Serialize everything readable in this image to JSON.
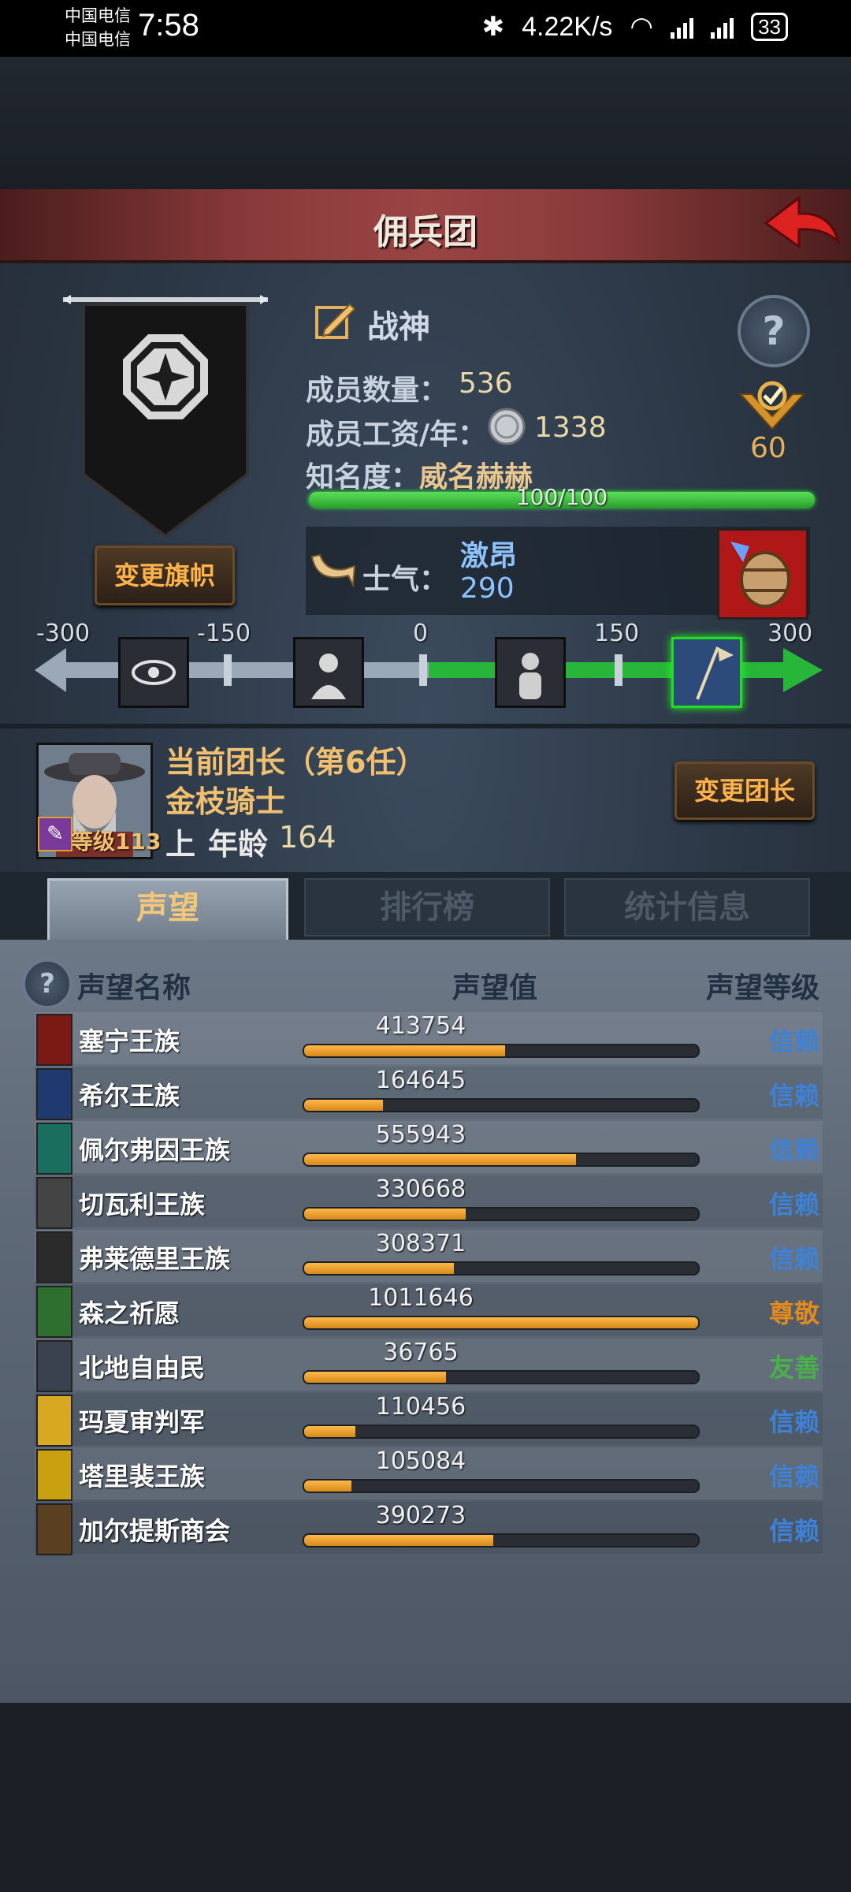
{
  "status": {
    "carrier1": "中国电信",
    "carrier2": "中国电信",
    "time": "7:58",
    "speed": "4.22K/s",
    "battery": "33"
  },
  "header": {
    "title": "佣兵团"
  },
  "guild": {
    "name": "战神",
    "member_count_label": "成员数量：",
    "member_count": "536",
    "wage_label": "成员工资/年：",
    "wage": "1338",
    "fame_label": "知名度：",
    "fame_value": "威名赫赫",
    "fame_text": "100/100",
    "fame_progress": 1.0,
    "rank_value": "60",
    "change_flag": "变更旗帜",
    "help": "?"
  },
  "morale": {
    "label": "士气：",
    "state": "激昂",
    "value": "290",
    "ticks": [
      "-300",
      "-150",
      "0",
      "150",
      "300"
    ],
    "level": 290,
    "range": [
      -300,
      300
    ]
  },
  "leader": {
    "title": "当前团长（第6任）",
    "name": "金枝骑士",
    "level": "等级113",
    "rank": "上",
    "age_label": "年龄",
    "age": "164",
    "change_button": "变更团长"
  },
  "tabs": [
    "声望",
    "排行榜",
    "统计信息"
  ],
  "table": {
    "col_name": "声望名称",
    "col_value": "声望值",
    "col_level": "声望等级",
    "rows": [
      {
        "name": "塞宁王族",
        "value": "413754",
        "fill": 0.51,
        "level": "信赖",
        "color": "#3b82d8",
        "icon": "#7a1a14"
      },
      {
        "name": "希尔王族",
        "value": "164645",
        "fill": 0.2,
        "level": "信赖",
        "color": "#3b82d8",
        "icon": "#1e3a6e"
      },
      {
        "name": "佩尔弗因王族",
        "value": "555943",
        "fill": 0.69,
        "level": "信赖",
        "color": "#3b82d8",
        "icon": "#1a6e5e"
      },
      {
        "name": "切瓦利王族",
        "value": "330668",
        "fill": 0.41,
        "level": "信赖",
        "color": "#3b82d8",
        "icon": "#444444"
      },
      {
        "name": "弗莱德里王族",
        "value": "308371",
        "fill": 0.38,
        "level": "信赖",
        "color": "#3b82d8",
        "icon": "#2a2a2a"
      },
      {
        "name": "森之祈愿",
        "value": "1011646",
        "fill": 1.0,
        "level": "尊敬",
        "color": "#e08a20",
        "icon": "#2e6e2e"
      },
      {
        "name": "北地自由民",
        "value": "36765",
        "fill": 0.36,
        "level": "友善",
        "color": "#47b24a",
        "icon": "#3a4250"
      },
      {
        "name": "玛夏审判军",
        "value": "110456",
        "fill": 0.13,
        "level": "信赖",
        "color": "#3b82d8",
        "icon": "#d8a820"
      },
      {
        "name": "塔里裴王族",
        "value": "105084",
        "fill": 0.12,
        "level": "信赖",
        "color": "#3b82d8",
        "icon": "#c8a010"
      },
      {
        "name": "加尔提斯商会",
        "value": "390273",
        "fill": 0.48,
        "level": "信赖",
        "color": "#3b82d8",
        "icon": "#5a4020"
      }
    ]
  }
}
